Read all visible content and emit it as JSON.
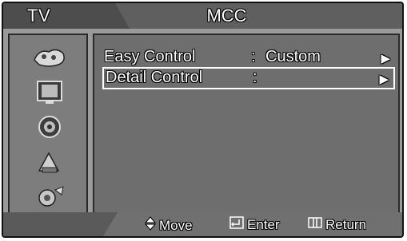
{
  "header": {
    "left_title": "TV",
    "center_title": "MCC"
  },
  "sidebar": {
    "icons": [
      {
        "name": "input-icon"
      },
      {
        "name": "picture-icon"
      },
      {
        "name": "sound-icon"
      },
      {
        "name": "channel-icon"
      },
      {
        "name": "setup-icon"
      }
    ]
  },
  "menu": {
    "items": [
      {
        "label": "Easy Control",
        "separator": ":",
        "value": "Custom",
        "arrow": "▶"
      },
      {
        "label": "Detail Control",
        "separator": ":",
        "value": "",
        "arrow": "▶"
      }
    ],
    "selected_index": 1
  },
  "footer": {
    "move_label": "Move",
    "enter_label": "Enter",
    "return_label": "Return"
  },
  "colors": {
    "frame_bg": "#9a9a9a",
    "panel_bg": "#6e6e6e",
    "header_bg": "#5f5f5f",
    "text": "#ffffff"
  }
}
